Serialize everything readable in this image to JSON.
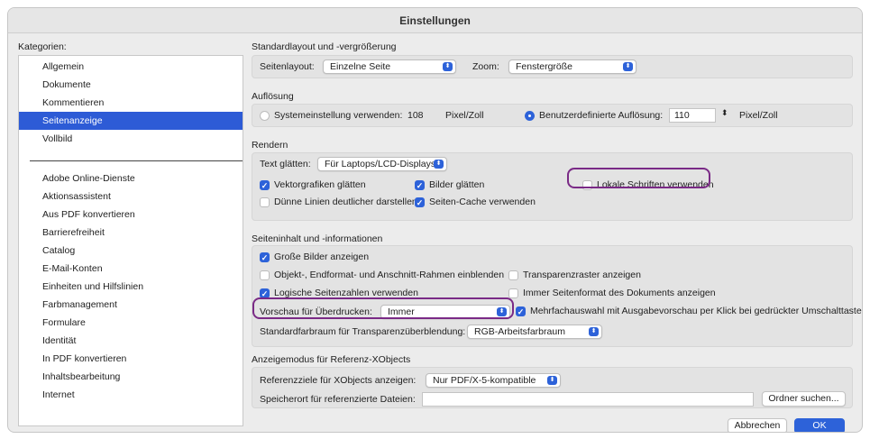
{
  "window": {
    "title": "Einstellungen"
  },
  "categories": {
    "label": "Kategorien:",
    "group1": [
      "Allgemein",
      "Dokumente",
      "Kommentieren",
      "Seitenanzeige",
      "Vollbild"
    ],
    "group2": [
      "Adobe Online-Dienste",
      "Aktionsassistent",
      "Aus PDF konvertieren",
      "Barrierefreiheit",
      "Catalog",
      "E-Mail-Konten",
      "Einheiten und Hilfslinien",
      "Farbmanagement",
      "Formulare",
      "Identität",
      "In PDF konvertieren",
      "Inhaltsbearbeitung",
      "Internet"
    ],
    "selected": "Seitenanzeige"
  },
  "layout_section": {
    "title": "Standardlayout und -vergrößerung",
    "page_layout_label": "Seitenlayout:",
    "page_layout_value": "Einzelne Seite",
    "zoom_label": "Zoom:",
    "zoom_value": "Fenstergröße"
  },
  "resolution_section": {
    "title": "Auflösung",
    "system_label": "Systemeinstellung verwenden:",
    "system_value": "108",
    "system_unit": "Pixel/Zoll",
    "custom_label": "Benutzerdefinierte Auflösung:",
    "custom_value": "110",
    "custom_unit": "Pixel/Zoll",
    "system_selected": false,
    "custom_selected": true
  },
  "render_section": {
    "title": "Rendern",
    "smooth_text_label": "Text glätten:",
    "smooth_text_value": "Für Laptops/LCD-Displays",
    "vector_label": "Vektorgrafiken glätten",
    "vector_checked": true,
    "images_label": "Bilder glätten",
    "images_checked": true,
    "local_fonts_label": "Lokale Schriften verwenden",
    "local_fonts_checked": false,
    "thin_lines_label": "Dünne Linien deutlicher darstellen",
    "thin_lines_checked": false,
    "cache_label": "Seiten-Cache verwenden",
    "cache_checked": true
  },
  "content_section": {
    "title": "Seiteninhalt und -informationen",
    "large_images_label": "Große Bilder anzeigen",
    "large_images_checked": true,
    "frames_label": "Objekt-, Endformat- und Anschnitt-Rahmen einblenden",
    "frames_checked": false,
    "transparency_grid_label": "Transparenzraster anzeigen",
    "transparency_grid_checked": false,
    "logical_numbers_label": "Logische Seitenzahlen verwenden",
    "logical_numbers_checked": true,
    "always_format_label": "Immer Seitenformat des Dokuments anzeigen",
    "always_format_checked": false,
    "overprint_label": "Vorschau für Überdrucken:",
    "overprint_value": "Immer",
    "multi_select_label": "Mehrfachauswahl mit Ausgabevorschau per Klick bei gedrückter Umschalttaste",
    "multi_select_checked": true,
    "blend_space_label": "Standardfarbraum für Transparenzüberblendung:",
    "blend_space_value": "RGB-Arbeitsfarbraum"
  },
  "xobjects_section": {
    "title": "Anzeigemodus für Referenz-XObjects",
    "show_targets_label": "Referenzziele für XObjects anzeigen:",
    "show_targets_value": "Nur PDF/X-5-kompatible",
    "location_label": "Speicherort für referenzierte Dateien:",
    "location_value": "",
    "browse_label": "Ordner suchen..."
  },
  "footer": {
    "cancel_label": "Abbrechen",
    "ok_label": "OK"
  },
  "colors": {
    "accent": "#2d62d9",
    "selection": "#2d5bd6",
    "highlight": "#7a2a86"
  }
}
